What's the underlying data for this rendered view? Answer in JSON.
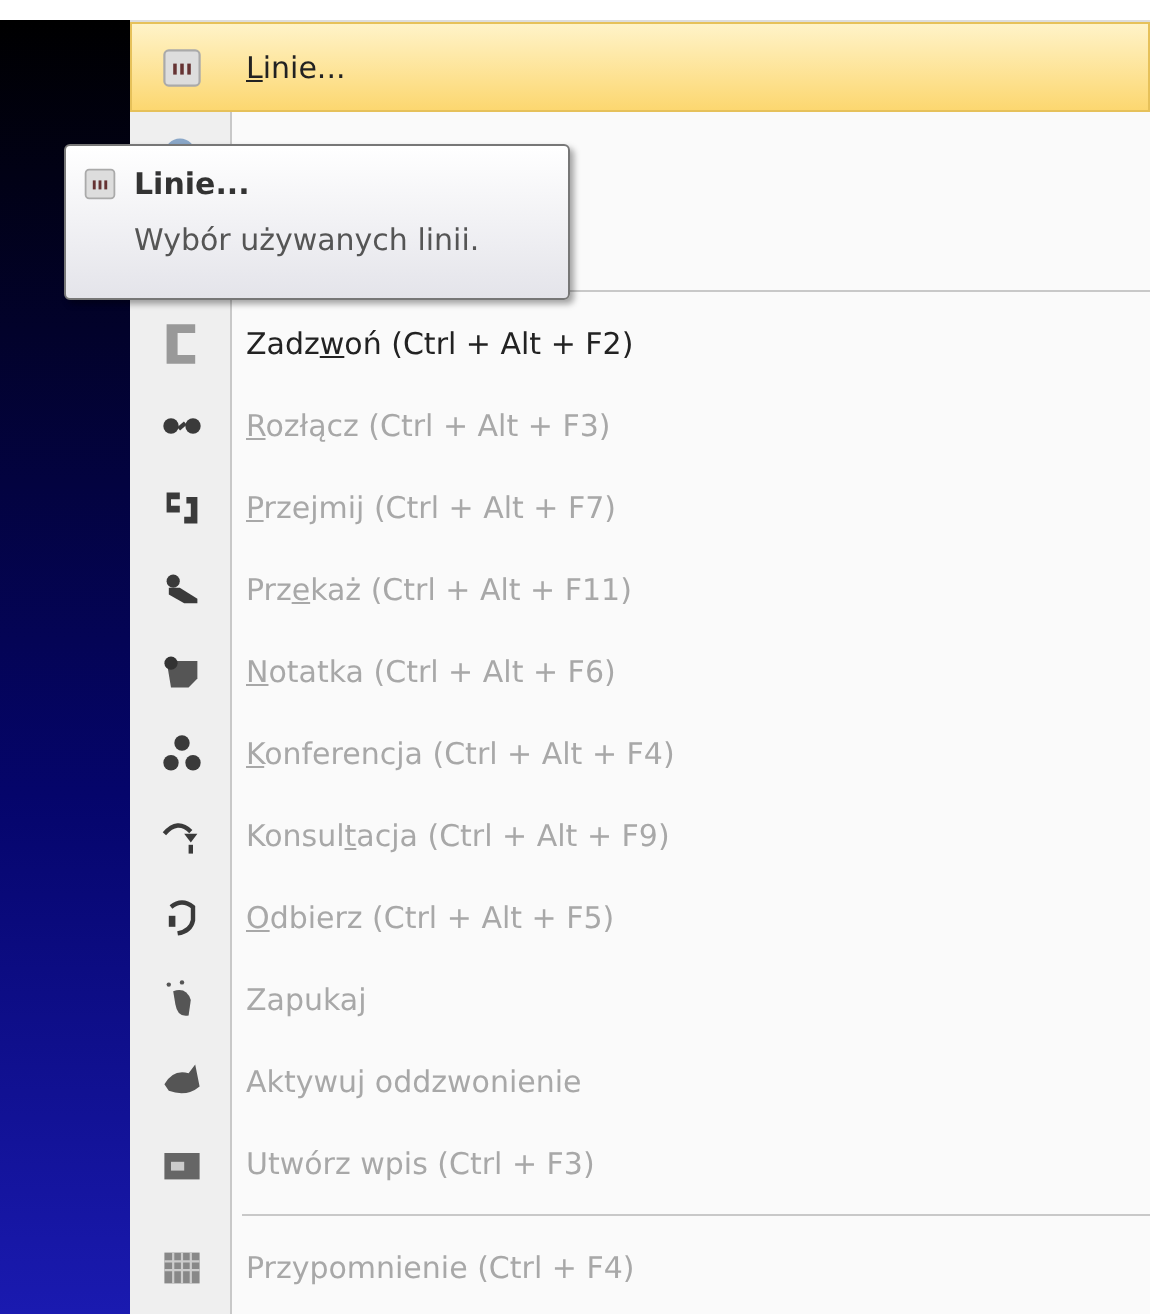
{
  "menu": {
    "items": [
      {
        "kind": "item",
        "key": "L",
        "post": "inie...",
        "selected": true,
        "disabled": false
      },
      {
        "kind": "hidden"
      },
      {
        "kind": "separator"
      },
      {
        "kind": "item",
        "pre": "Zadz",
        "key": "w",
        "post": "oń (Ctrl + Alt + F2)",
        "selected": false,
        "disabled": false
      },
      {
        "kind": "item",
        "key": "R",
        "post": "ozłącz (Ctrl + Alt + F3)",
        "selected": false,
        "disabled": true
      },
      {
        "kind": "item",
        "key": "P",
        "post": "rzejmij (Ctrl + Alt + F7)",
        "selected": false,
        "disabled": true
      },
      {
        "kind": "item",
        "pre": "Prz",
        "key": "e",
        "post": "każ (Ctrl + Alt + F11)",
        "selected": false,
        "disabled": true
      },
      {
        "kind": "item",
        "key": "N",
        "post": "otatka (Ctrl + Alt + F6)",
        "selected": false,
        "disabled": true
      },
      {
        "kind": "item",
        "key": "K",
        "post": "onferencja (Ctrl + Alt + F4)",
        "selected": false,
        "disabled": true
      },
      {
        "kind": "item",
        "pre": "Konsul",
        "key": "t",
        "post": "acja (Ctrl + Alt + F9)",
        "selected": false,
        "disabled": true
      },
      {
        "kind": "item",
        "key": "O",
        "post": "dbierz (Ctrl + Alt + F5)",
        "selected": false,
        "disabled": true
      },
      {
        "kind": "item",
        "pre": "Zapukaj",
        "selected": false,
        "disabled": true
      },
      {
        "kind": "item",
        "pre": "Aktywuj oddzwonienie",
        "selected": false,
        "disabled": true
      },
      {
        "kind": "item",
        "pre": "Utwórz wpis (Ctrl + F3)",
        "selected": false,
        "disabled": true
      },
      {
        "kind": "separator"
      },
      {
        "kind": "item",
        "pre": "Przypomnienie (Ctrl + F4)",
        "selected": false,
        "disabled": true
      }
    ]
  },
  "tooltip": {
    "title": "Linie...",
    "description": "Wybór używanych linii."
  }
}
